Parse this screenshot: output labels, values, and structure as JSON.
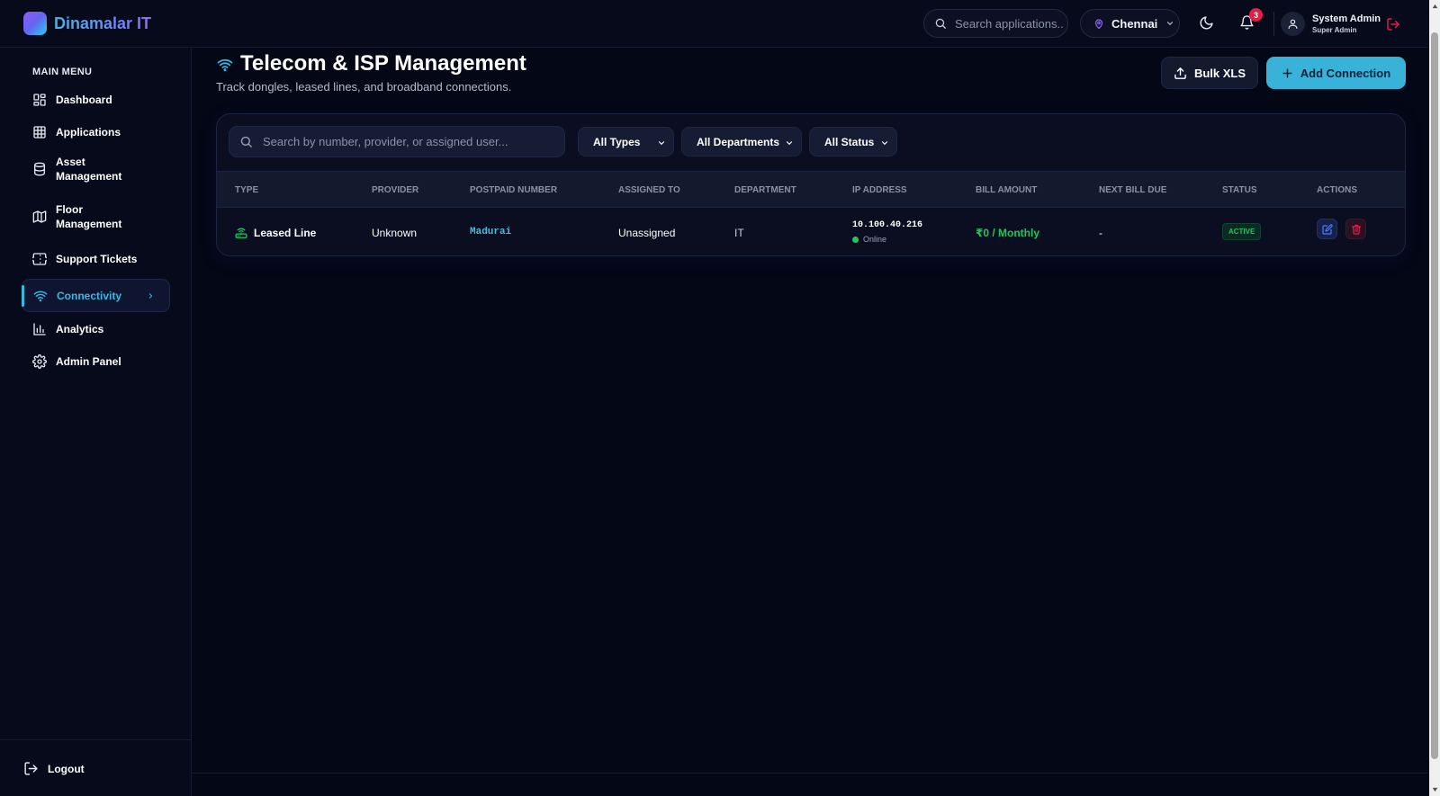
{
  "brand": {
    "name": "Dinamalar IT"
  },
  "topbar": {
    "search_placeholder": "Search applications...",
    "location": "Chennai",
    "notifications_count": "3",
    "user_name": "System Admin",
    "user_role": "Super Admin"
  },
  "sidebar": {
    "section_title": "MAIN MENU",
    "items": [
      {
        "label": "Dashboard",
        "icon": "dashboard-icon"
      },
      {
        "label": "Applications",
        "icon": "grid-icon"
      },
      {
        "label": "Asset Management",
        "icon": "database-icon"
      },
      {
        "label": "Floor Management",
        "icon": "map-icon"
      },
      {
        "label": "Support Tickets",
        "icon": "ticket-icon"
      },
      {
        "label": "Connectivity",
        "icon": "wifi-icon",
        "active": true
      },
      {
        "label": "Analytics",
        "icon": "bar-chart-icon"
      },
      {
        "label": "Admin Panel",
        "icon": "gear-icon"
      }
    ],
    "logout_label": "Logout"
  },
  "page": {
    "title": "Telecom & ISP Management",
    "subtitle": "Track dongles, leased lines, and broadband connections.",
    "bulk_label": "Bulk XLS",
    "add_label": "Add Connection"
  },
  "filters": {
    "search_placeholder": "Search by number, provider, or assigned user...",
    "type": "All Types",
    "department": "All Departments",
    "status": "All Status"
  },
  "table": {
    "columns": [
      "TYPE",
      "PROVIDER",
      "POSTPAID NUMBER",
      "ASSIGNED TO",
      "DEPARTMENT",
      "IP ADDRESS",
      "BILL AMOUNT",
      "NEXT BILL DUE",
      "STATUS",
      "ACTIONS"
    ],
    "rows": [
      {
        "type": "Leased Line",
        "provider": "Unknown",
        "postpaid_number": "Madurai",
        "assigned_to": "Unassigned",
        "department": "IT",
        "ip_address": "10.100.40.216",
        "ip_status": "Online",
        "bill_amount": "₹0 / Monthly",
        "next_bill_due": "-",
        "status": "ACTIVE"
      }
    ]
  },
  "colors": {
    "accent": "#38b2d8",
    "success": "#22c55e",
    "danger": "#e11d48",
    "background": "#040715"
  }
}
